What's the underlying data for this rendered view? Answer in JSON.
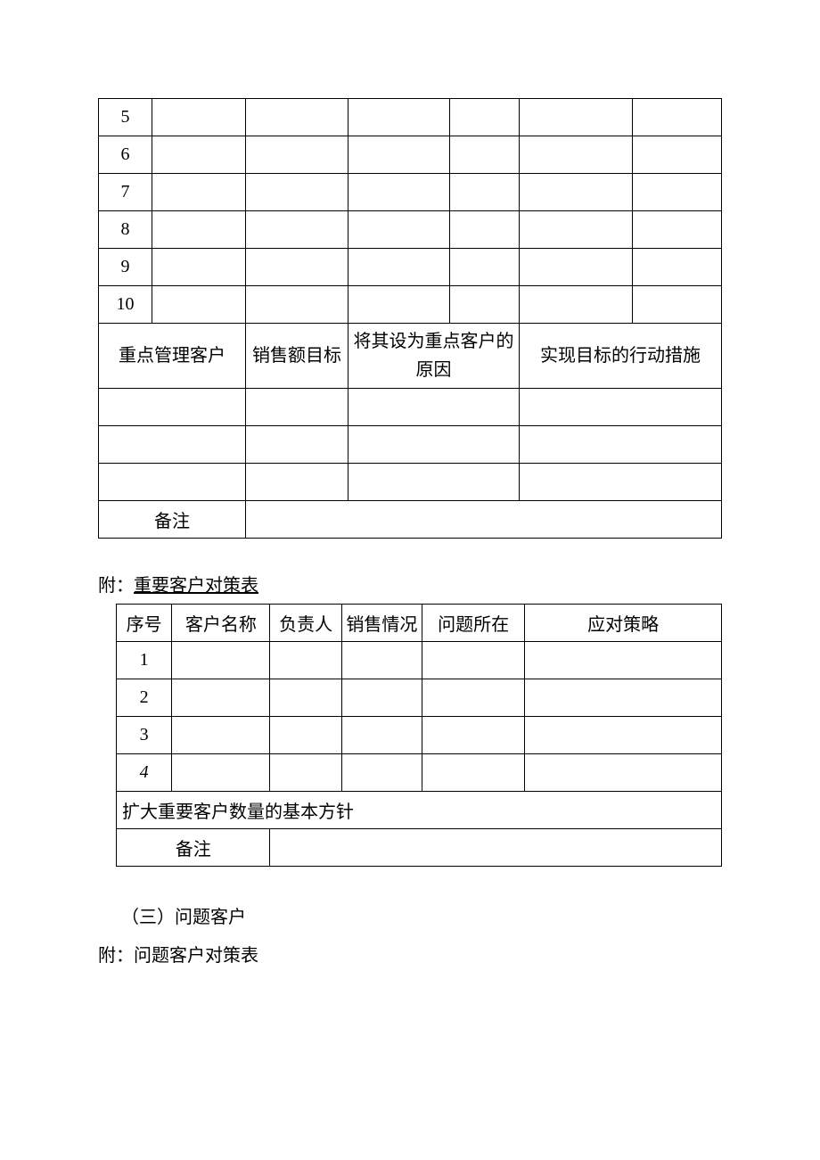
{
  "table1": {
    "rows": [
      "5",
      "6",
      "7",
      "8",
      "9",
      "10"
    ],
    "header2": {
      "col1": "重点管理客户",
      "col2": "销售额目标",
      "col3": "将其设为重点客户的原因",
      "col4": "实现目标的行动措施"
    },
    "remark_label": "备注"
  },
  "caption1_prefix": "附：",
  "caption1_text": "重要客户对策表",
  "table2": {
    "headers": {
      "seq": "序号",
      "name": "客户名称",
      "owner": "负责人",
      "sales": "销售情况",
      "issue": "问题所在",
      "strategy": "应对策略"
    },
    "rows": [
      "1",
      "2",
      "3",
      "4"
    ],
    "expand_label": "扩大重要客户数量的基本方针",
    "remark_label": "备注"
  },
  "section3": "（三）问题客户",
  "caption2": "附：问题客户对策表"
}
